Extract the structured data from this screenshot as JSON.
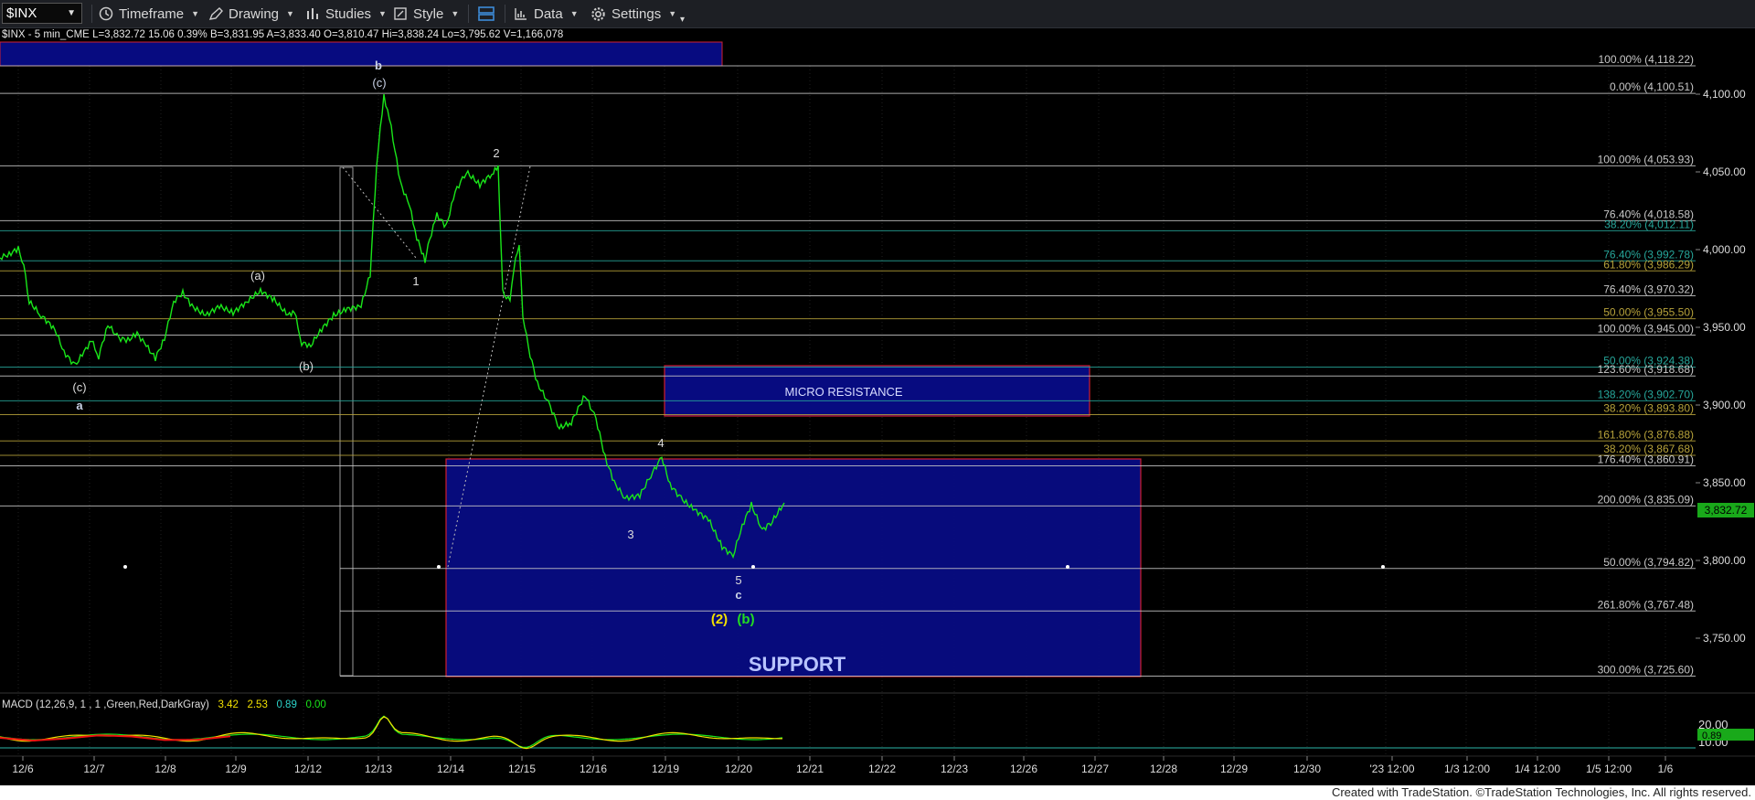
{
  "toolbar": {
    "symbol": "$INX",
    "timeframe": "Timeframe",
    "drawing": "Drawing",
    "studies": "Studies",
    "style": "Style",
    "data": "Data",
    "settings": "Settings"
  },
  "symbol_info": {
    "name": "$INX - 5 min_CME",
    "last": "L=3,832.72",
    "change": "15.06",
    "change_pct": "0.39%",
    "bid": "B=3,831.95",
    "ask": "A=3,833.40",
    "open": "O=3,810.47",
    "high": "Hi=3,838.24",
    "low": "Lo=3,795.62",
    "volume": "V=1,166,078"
  },
  "price_axis": {
    "ticks": [
      "4,100.00",
      "4,050.00",
      "4,000.00",
      "3,950.00",
      "3,900.00",
      "3,850.00",
      "3,800.00",
      "3,750.00"
    ],
    "last_price": "3,832.72",
    "macd_ticks": [
      "20.00",
      "10.00"
    ],
    "macd_value": "0.89"
  },
  "time_axis": {
    "ticks": [
      "12/6",
      "12/7",
      "12/8",
      "12/9",
      "12/12",
      "12/13",
      "12/14",
      "12/15",
      "12/16",
      "12/19",
      "12/20",
      "12/21",
      "12/22",
      "12/23",
      "12/26",
      "12/27",
      "12/28",
      "12/29",
      "12/30",
      "'23 12:00",
      "1/3 12:00",
      "1/4 12:00",
      "1/5 12:00",
      "1/6"
    ]
  },
  "fib_levels": [
    {
      "label": "100.00% (4,118.22)",
      "price": 4118.22,
      "color": "#c8c8c8"
    },
    {
      "label": "0.00% (4,100.51)",
      "price": 4100.51,
      "color": "#c8c8c8"
    },
    {
      "label": "100.00% (4,053.93)",
      "price": 4053.93,
      "color": "#c8c8c8"
    },
    {
      "label": "76.40% (4,018.58)",
      "price": 4018.58,
      "color": "#c8c8c8"
    },
    {
      "label": "38.20% (4,012.11)",
      "price": 4012.11,
      "color": "#26a69a"
    },
    {
      "label": "76.40% (3,992.78)",
      "price": 3992.78,
      "color": "#26a69a"
    },
    {
      "label": "61.80% (3,986.29)",
      "price": 3986.29,
      "color": "#b7a23a"
    },
    {
      "label": "76.40% (3,970.32)",
      "price": 3970.32,
      "color": "#c8c8c8"
    },
    {
      "label": "50.00% (3,955.50)",
      "price": 3955.5,
      "color": "#b7a23a"
    },
    {
      "label": "100.00% (3,945.00)",
      "price": 3945.0,
      "color": "#c8c8c8"
    },
    {
      "label": "50.00% (3,924.38)",
      "price": 3924.38,
      "color": "#26a69a"
    },
    {
      "label": "123.60% (3,918.68)",
      "price": 3918.68,
      "color": "#c8c8c8"
    },
    {
      "label": "138.20% (3,902.70)",
      "price": 3902.7,
      "color": "#26a69a"
    },
    {
      "label": "38.20% (3,893.80)",
      "price": 3893.8,
      "color": "#b7a23a"
    },
    {
      "label": "161.80% (3,876.88)",
      "price": 3876.88,
      "color": "#b7a23a"
    },
    {
      "label": "38.20% (3,867.68)",
      "price": 3867.68,
      "color": "#b7a23a"
    },
    {
      "label": "176.40% (3,860.91)",
      "price": 3860.91,
      "color": "#c8c8c8"
    },
    {
      "label": "200.00% (3,835.09)",
      "price": 3835.09,
      "color": "#c8c8c8"
    },
    {
      "label": "50.00% (3,794.82)",
      "price": 3794.82,
      "color": "#c8c8c8"
    },
    {
      "label": "261.80% (3,767.48)",
      "price": 3767.48,
      "color": "#c8c8c8"
    },
    {
      "label": "300.00% (3,725.60)",
      "price": 3725.6,
      "color": "#c8c8c8"
    }
  ],
  "zones": {
    "resistance_label": "MICRO RESISTANCE",
    "support_label": "SUPPORT"
  },
  "wave_labels": {
    "b": "b",
    "c_top": "(c)",
    "two": "2",
    "one": "1",
    "a_paren": "(a)",
    "b_paren": "(b)",
    "c_paren_low": "(c)",
    "a": "a",
    "four": "4",
    "three": "3",
    "five": "5",
    "c": "c",
    "two_paren": "(2)",
    "b_green": "(b)"
  },
  "macd": {
    "label": "MACD (12,26,9, 1 , 1 ,Green,Red,DarkGray)",
    "v1": "3.42",
    "v2": "2.53",
    "v3": "0.89",
    "v4": "0.00"
  },
  "footer": "Created with TradeStation. ©TradeStation Technologies, Inc. All rights reserved.",
  "colors": {
    "price_line": "#19e619",
    "zone_fill": "#070b80",
    "zone_border": "#d01f2f",
    "last_price_bg": "#19a91a"
  }
}
